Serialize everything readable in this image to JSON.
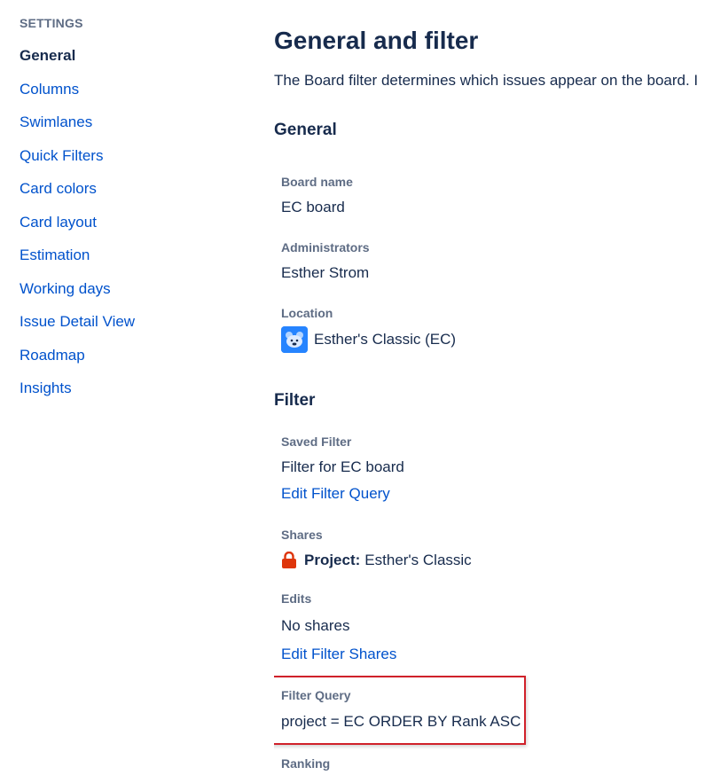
{
  "sidebar": {
    "heading": "SETTINGS",
    "items": [
      {
        "label": "General",
        "active": true
      },
      {
        "label": "Columns"
      },
      {
        "label": "Swimlanes"
      },
      {
        "label": "Quick Filters"
      },
      {
        "label": "Card colors"
      },
      {
        "label": "Card layout"
      },
      {
        "label": "Estimation"
      },
      {
        "label": "Working days"
      },
      {
        "label": "Issue Detail View"
      },
      {
        "label": "Roadmap"
      },
      {
        "label": "Insights"
      }
    ]
  },
  "main": {
    "title": "General and filter",
    "description": "The Board filter determines which issues appear on the board. I",
    "general": {
      "heading": "General",
      "board_name_label": "Board name",
      "board_name_value": "EC board",
      "administrators_label": "Administrators",
      "administrators_value": "Esther Strom",
      "location_label": "Location",
      "location_value": "Esther's Classic (EC)"
    },
    "filter": {
      "heading": "Filter",
      "saved_filter_label": "Saved Filter",
      "saved_filter_value": "Filter for EC board",
      "edit_filter_query_link": "Edit Filter Query",
      "shares_label": "Shares",
      "shares_prefix": "Project:",
      "shares_value": "Esther's Classic",
      "edits_label": "Edits",
      "edits_value": "No shares",
      "edit_filter_shares_link": "Edit Filter Shares",
      "filter_query_label": "Filter Query",
      "filter_query_value": "project = EC ORDER BY Rank ASC",
      "ranking_label": "Ranking"
    }
  },
  "colors": {
    "link": "#0052cc",
    "text": "#172b4d",
    "muted": "#5e6c84",
    "highlight": "#d0212a",
    "lock": "#de350b",
    "avatar": "#2684ff"
  },
  "icons": {
    "location": "project-avatar-icon",
    "shares": "lock-icon"
  }
}
